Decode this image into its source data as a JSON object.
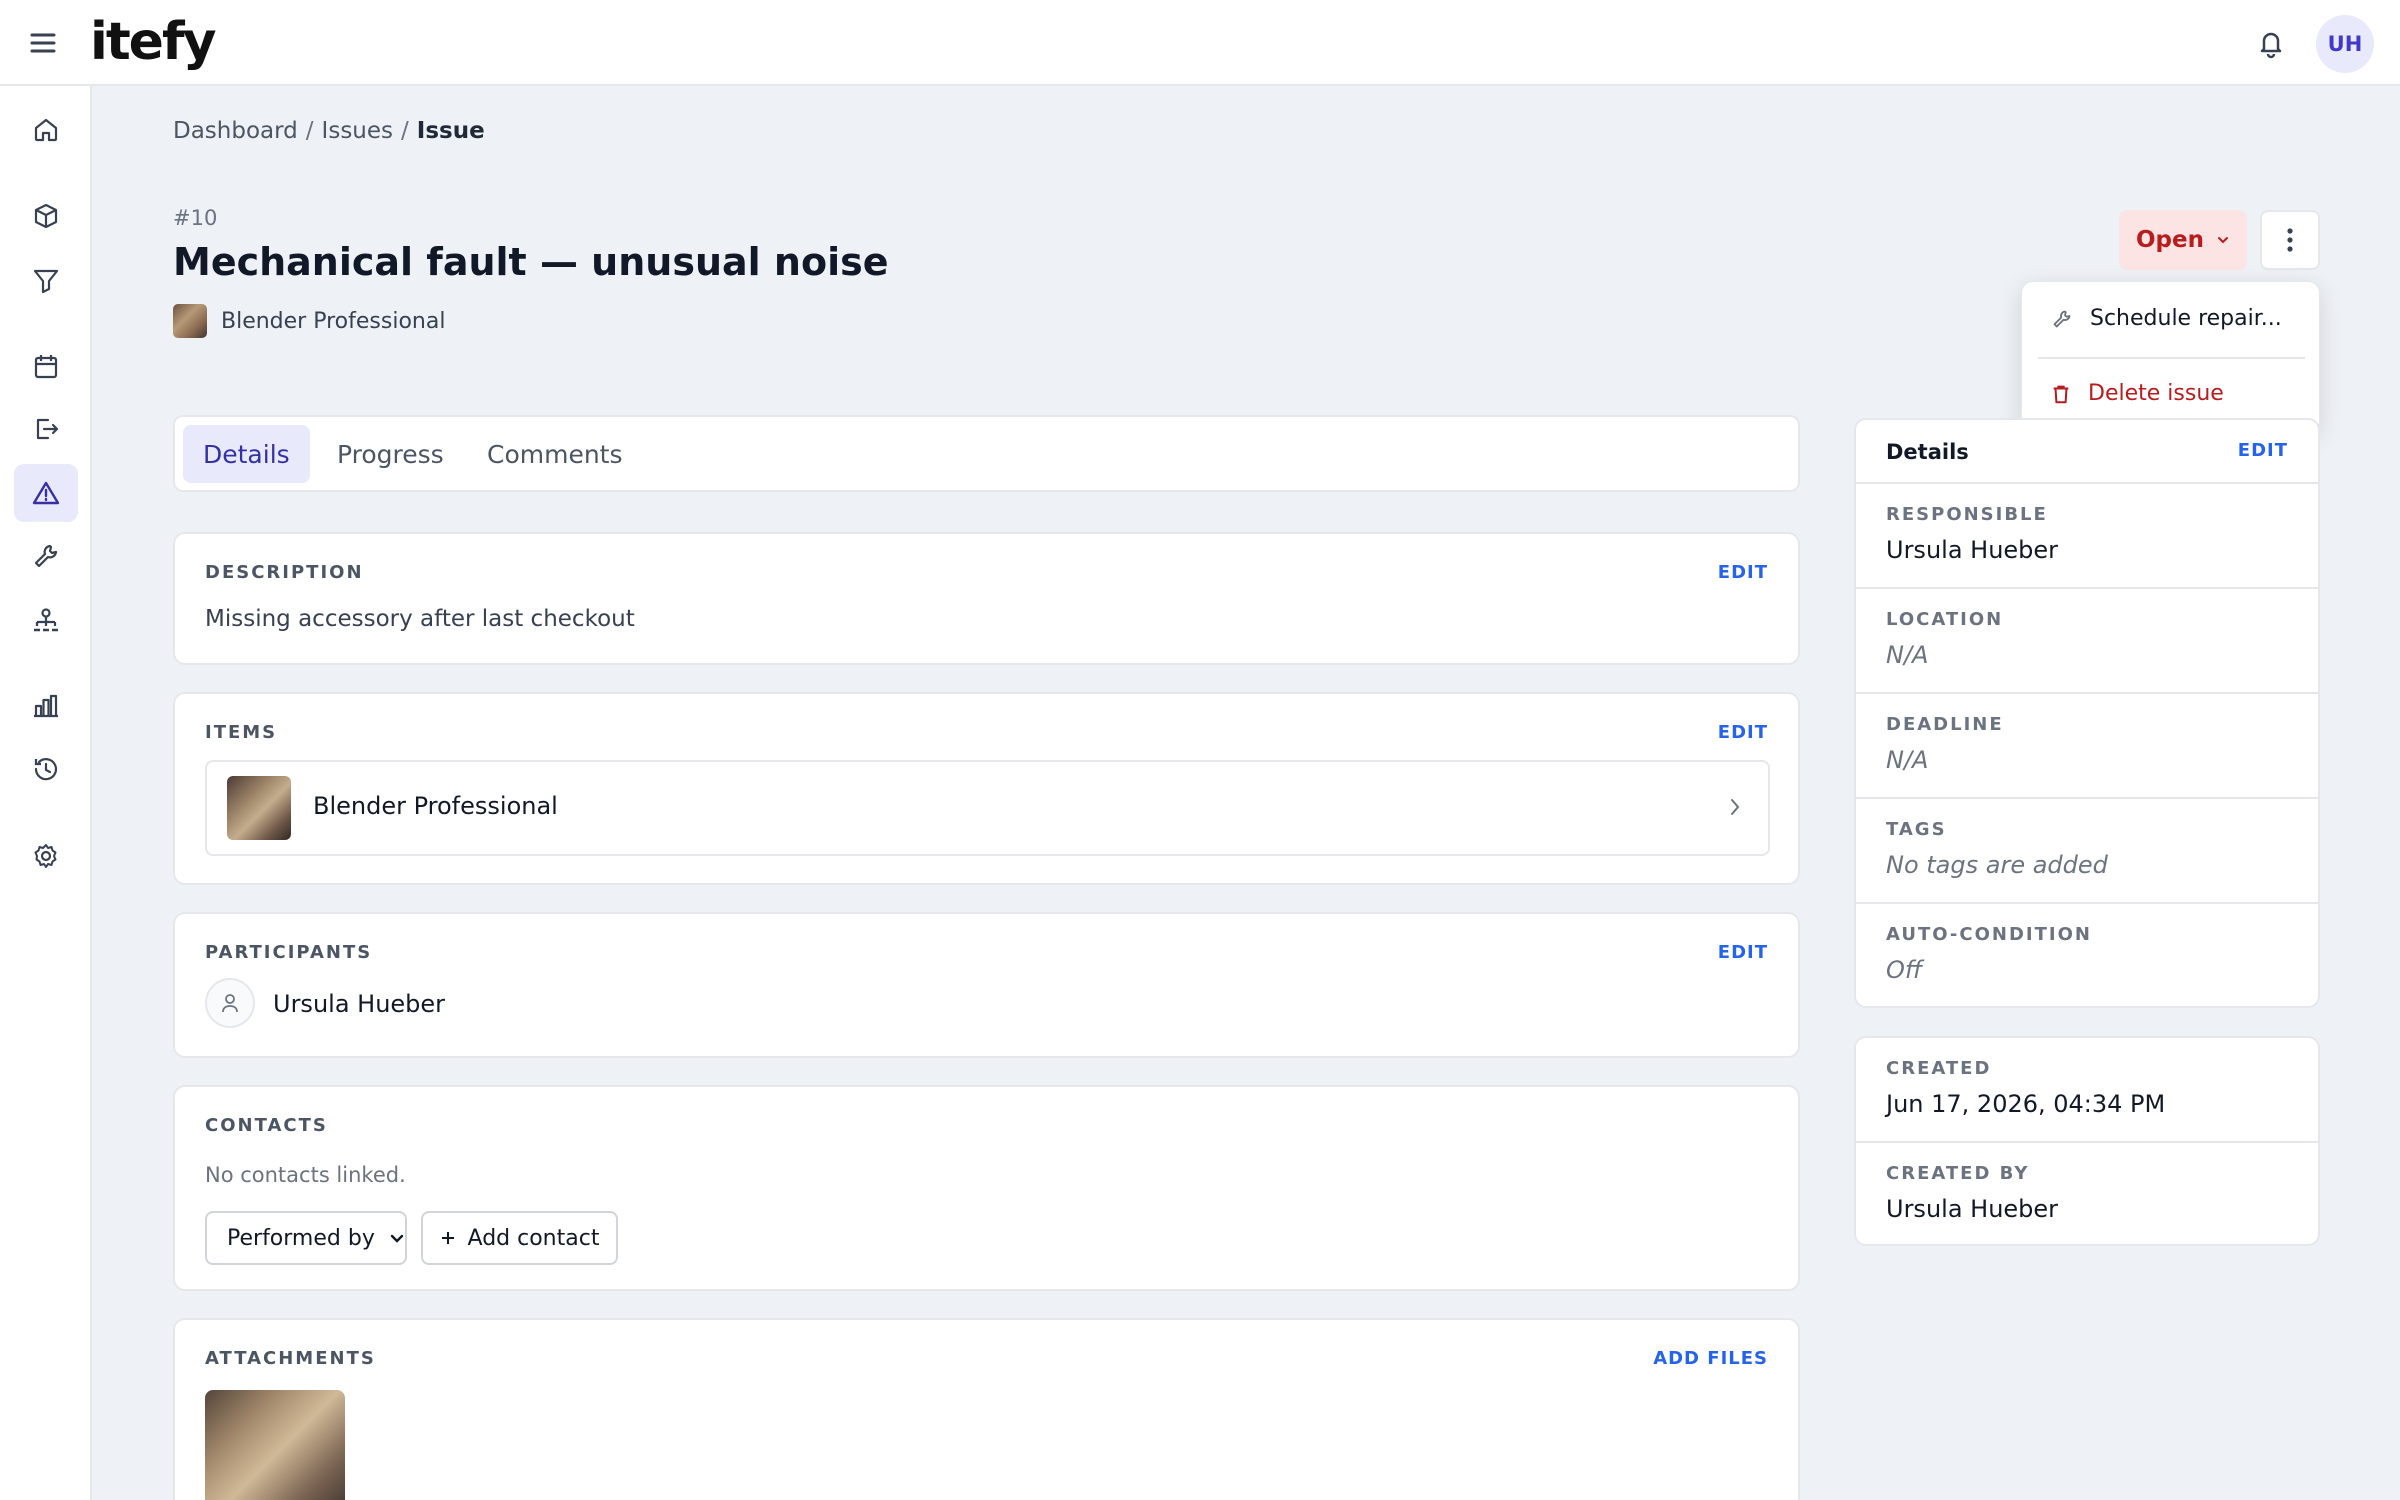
{
  "app": {
    "logo": "itefy",
    "user_initials": "UH"
  },
  "icons": {
    "menu": "hamburger-icon",
    "bell": "bell-icon",
    "nav": [
      "home-icon",
      "box-icon",
      "filter-icon",
      "calendar-icon",
      "checkout-icon",
      "warning-icon",
      "wrench-icon",
      "org-chart-icon",
      "bar-chart-icon",
      "history-icon",
      "gear-icon"
    ]
  },
  "breadcrumb": [
    "Dashboard",
    "Issues",
    "Issue"
  ],
  "breadcrumb_sep": "/",
  "issue": {
    "number": "#10",
    "title": "Mechanical fault — unusual noise",
    "asset": "Blender Professional",
    "status": "Open"
  },
  "menu": {
    "schedule": "Schedule repair...",
    "delete": "Delete issue"
  },
  "tabs": [
    "Details",
    "Progress",
    "Comments"
  ],
  "cards": {
    "description": {
      "label": "DESCRIPTION",
      "edit": "EDIT",
      "text": "Missing accessory after last checkout"
    },
    "items": {
      "label": "ITEMS",
      "edit": "EDIT",
      "item": "Blender Professional"
    },
    "participants": {
      "label": "PARTICIPANTS",
      "edit": "EDIT",
      "name": "Ursula Hueber"
    },
    "contacts": {
      "label": "CONTACTS",
      "empty": "No contacts linked.",
      "select": "Performed by",
      "add": "Add contact"
    },
    "attachments": {
      "label": "ATTACHMENTS",
      "add": "ADD FILES"
    }
  },
  "details_panel": {
    "title": "Details",
    "edit": "EDIT",
    "rows": [
      {
        "label": "RESPONSIBLE",
        "value": "Ursula Hueber"
      },
      {
        "label": "LOCATION",
        "value": "N/A"
      },
      {
        "label": "DEADLINE",
        "value": "N/A"
      },
      {
        "label": "TAGS",
        "value": "No tags are added"
      },
      {
        "label": "AUTO-CONDITION",
        "value": "Off"
      }
    ]
  },
  "meta_panel": {
    "rows": [
      {
        "label": "CREATED",
        "value": "Jun 17, 2026, 04:34 PM"
      },
      {
        "label": "CREATED BY",
        "value": "Ursula Hueber"
      }
    ]
  },
  "colors": {
    "accent": "#2563eb",
    "active_bg": "#e8e9fb",
    "danger": "#b91c1c",
    "status_bg": "#fde4e4"
  }
}
